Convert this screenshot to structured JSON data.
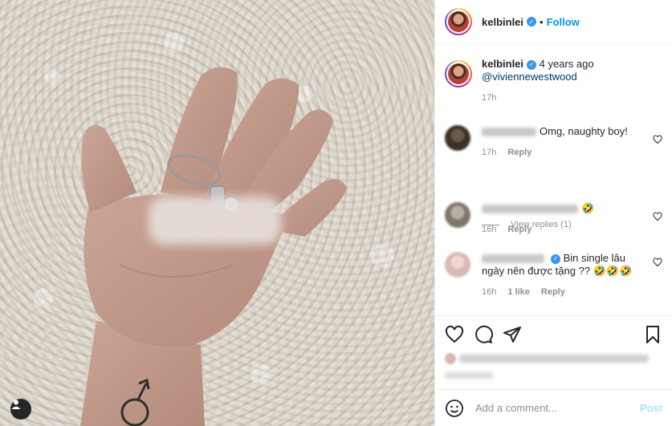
{
  "post": {
    "username": "kelbinlei",
    "follow_label": "Follow",
    "dot": "•"
  },
  "caption": {
    "username": "kelbinlei",
    "age": "4 years ago",
    "mention": "@viviennewestwood",
    "time": "17h"
  },
  "comments": [
    {
      "text": "Omg, naughty boy!",
      "time": "17h",
      "reply_label": "Reply",
      "likes": ""
    },
    {
      "text": "",
      "time": "16h",
      "reply_label": "Reply",
      "likes": ""
    },
    {
      "text": "Bin single lâu ngày nên được tặng ?? 🤣🤣🤣",
      "time": "16h",
      "reply_label": "Reply",
      "likes": "1 like"
    }
  ],
  "view_replies": "View replies (1)",
  "emoji_tail": "🤣",
  "add_comment": {
    "placeholder": "Add a comment...",
    "post_label": "Post"
  },
  "icons": {
    "like": "heart-icon",
    "comment": "comment-bubble-icon",
    "share": "paper-plane-icon",
    "save": "bookmark-icon",
    "emoji": "smiley-icon",
    "user": "user-tag-icon"
  },
  "colors": {
    "link": "#0095f6",
    "verified": "#3897f0",
    "muted": "#8e8e8e",
    "post_disabled": "#b2dffc"
  }
}
